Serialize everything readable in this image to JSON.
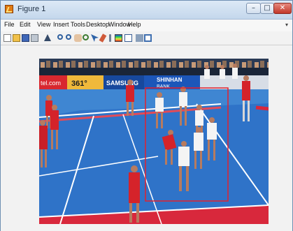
{
  "window": {
    "title": "Figure 1",
    "controls": {
      "minimize": "–",
      "maximize": "□",
      "close": "✕"
    }
  },
  "menubar": {
    "items": [
      "File",
      "Edit",
      "View",
      "Insert",
      "Tools",
      "Desktop",
      "Window",
      "Help"
    ],
    "overflow": "▾"
  },
  "toolbar": {
    "icons": [
      "new-figure-icon",
      "open-file-icon",
      "save-icon",
      "print-icon",
      "select-arrow-icon",
      "zoom-in-icon",
      "zoom-out-icon",
      "pan-hand-icon",
      "rotate-3d-icon",
      "data-cursor-icon",
      "brush-icon",
      "link-icon",
      "colorbar-icon",
      "legend-icon",
      "grid-icon",
      "dock-icon"
    ]
  },
  "image": {
    "ad_boards": {
      "telecom": "tel.com",
      "brand_361": "361°",
      "samsung": "SAMSUNG",
      "shinhan": "SHINHAN",
      "shinhan_sub": "BANK"
    },
    "bounding_box_color": "#e3212d",
    "court_color": "#3f86d2",
    "boundary_color": "#d8283c"
  },
  "colors": {
    "titlebar_top": "#dce9f6",
    "titlebar_bottom": "#c4d7ec",
    "figure_bg": "#f2f2f2"
  }
}
